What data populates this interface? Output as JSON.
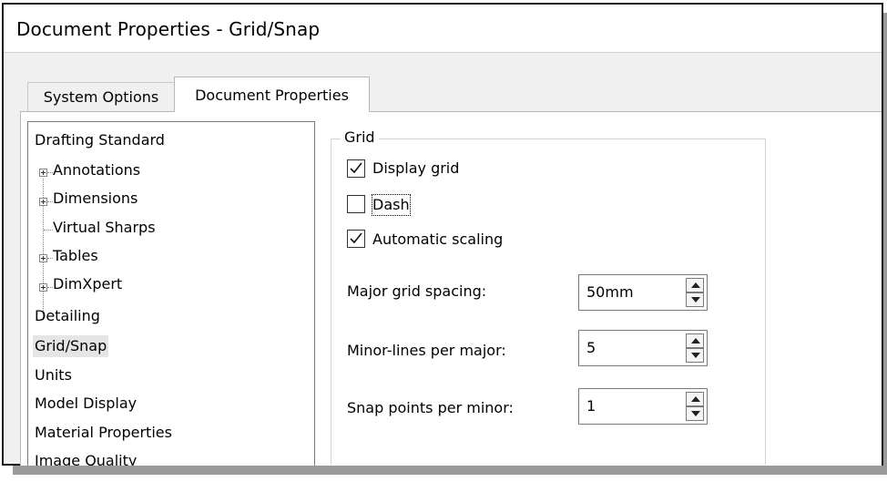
{
  "window": {
    "title": "Document Properties - Grid/Snap"
  },
  "tabs": [
    {
      "label": "System Options",
      "active": false
    },
    {
      "label": "Document Properties",
      "active": true
    }
  ],
  "tree": {
    "items": [
      {
        "label": "Drafting Standard"
      },
      {
        "label": "Annotations",
        "expandable": true
      },
      {
        "label": "Dimensions",
        "expandable": true
      },
      {
        "label": "Virtual Sharps",
        "expandable": false
      },
      {
        "label": "Tables",
        "expandable": true
      },
      {
        "label": "DimXpert",
        "expandable": true
      },
      {
        "label": "Detailing"
      },
      {
        "label": "Grid/Snap",
        "selected": true
      },
      {
        "label": "Units"
      },
      {
        "label": "Model Display"
      },
      {
        "label": "Material Properties"
      },
      {
        "label": "Image Quality"
      }
    ]
  },
  "grid": {
    "group_label": "Grid",
    "display_grid": {
      "label": "Display grid",
      "checked": true
    },
    "dash": {
      "label": "Dash",
      "checked": false
    },
    "automatic_scaling": {
      "label": "Automatic scaling",
      "checked": true
    },
    "major_spacing": {
      "label": "Major grid spacing:",
      "value": "50mm"
    },
    "minor_lines": {
      "label": "Minor-lines per major:",
      "value": "5"
    },
    "snap_points": {
      "label": "Snap points per minor:",
      "value": "1"
    }
  },
  "icons": {
    "expander": "plus-box-icon",
    "check": "checkmark-icon",
    "spin_up": "triangle-up-icon",
    "spin_down": "triangle-down-icon"
  }
}
